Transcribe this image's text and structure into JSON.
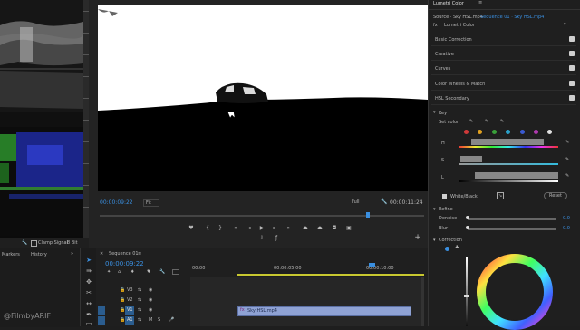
{
  "scopes": {
    "clamp_label": "Clamp Signal",
    "bit_depth": "8 Bit"
  },
  "program_monitor": {
    "timecode_current": "00:00:09:22",
    "zoom": "Fit",
    "resolution": "Full",
    "timecode_duration": "00:00:11:24"
  },
  "lumetri": {
    "panel_title": "Lumetri Color",
    "source_label": "Source · Sky HSL.mp4",
    "sequence_label": "Sequence 01 · Sky HSL.mp4",
    "fx_label": "fx",
    "effect_name": "Lumetri Color",
    "sections": [
      "Basic Correction",
      "Creative",
      "Curves",
      "Color Wheels & Match",
      "HSL Secondary"
    ],
    "key_label": "Key",
    "set_color_label": "Set color",
    "hsl_labels": [
      "H",
      "S",
      "L"
    ],
    "swatch_colors": [
      "#d03a3a",
      "#e0a020",
      "#3aa03a",
      "#2aa0c8",
      "#3a5ad0",
      "#b03ab0",
      "#e0e0e0"
    ],
    "show_mask": "White/Black",
    "reset_label": "Reset",
    "refine_label": "Refine",
    "denoise_label": "Denoise",
    "denoise_value": "0.0",
    "blur_label": "Blur",
    "blur_value": "0.0",
    "correction_label": "Correction"
  },
  "project": {
    "tabs": [
      "Markers",
      "History"
    ]
  },
  "timeline": {
    "tab_label": "Sequence 01",
    "timecode": "00:00:09:22",
    "ruler_labels": [
      "00:00",
      "00:00:05:00",
      "00:00:10:00"
    ],
    "tracks": [
      "V3",
      "V2",
      "V1",
      "A1"
    ],
    "clip_label": "Sky HSL.mp4"
  },
  "watermark": "@FilmbyARIF"
}
